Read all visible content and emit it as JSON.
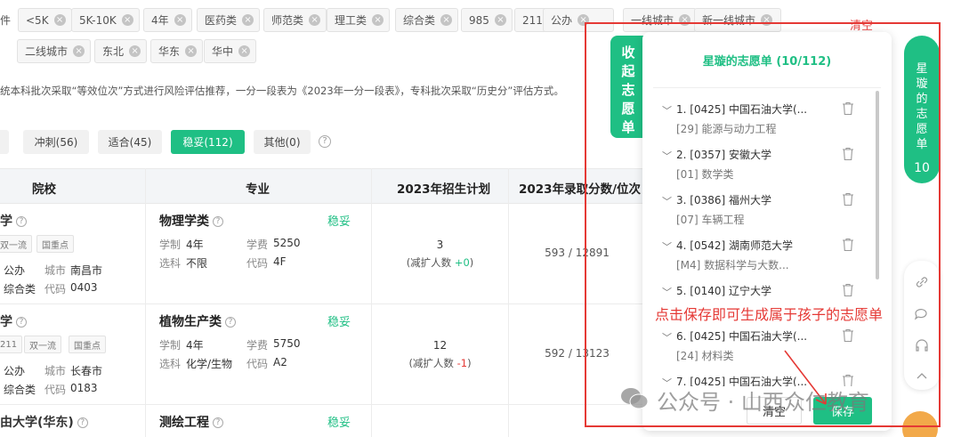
{
  "filters": {
    "row1_prefix": "件",
    "row1": [
      "<5K",
      "5K-10K",
      "4年",
      "医药类",
      "师范类",
      "理工类",
      "综合类",
      "985",
      "211",
      "公办",
      "一线城市",
      "新一线城市"
    ],
    "row2": [
      "二线城市",
      "东北",
      "华东",
      "华中"
    ],
    "clear_label": "清空"
  },
  "note": "统本科批次采取“等效位次”方式进行风险评估推荐，一分一段表为《2023年一分一段表》，专科批次采取“历史分”评估方式。",
  "category_tabs": {
    "partial_left": ")",
    "items": [
      "冲刺(56)",
      "适合(45)",
      "稳妥(112)",
      "其他(0)"
    ],
    "active": "稳妥(112)",
    "help": "?"
  },
  "table": {
    "headers": [
      "院校",
      "专业",
      "2023年招生计划",
      "2023年录取分数/位次"
    ],
    "rows": [
      {
        "school_partial": "学",
        "badges": [
          "双一流",
          "国重点"
        ],
        "nature_label": "公办",
        "city_label": "城市",
        "city": "南昌市",
        "type": "综合类",
        "code_label": "代码",
        "code": "0403",
        "major": "物理学类",
        "risk": "稳妥",
        "duration_label": "学制",
        "duration": "4年",
        "fee_label": "学费",
        "fee": "5250",
        "subject_label": "选科",
        "subject": "不限",
        "major_code_label": "代码",
        "major_code": "4F",
        "plan": "3",
        "plan_note_prefix": "(减扩人数 ",
        "plan_delta": "+0",
        "plan_note_suffix": ")",
        "score": "593 / 12891"
      },
      {
        "school_partial": "学",
        "badges": [
          "211",
          "双一流",
          "国重点"
        ],
        "nature_label": "公办",
        "city_label": "城市",
        "city": "长春市",
        "type": "综合类",
        "code_label": "代码",
        "code": "0183",
        "major": "植物生产类",
        "risk": "稳妥",
        "duration_label": "学制",
        "duration": "4年",
        "fee_label": "学费",
        "fee": "5750",
        "subject_label": "选科",
        "subject": "化学/生物",
        "major_code_label": "代码",
        "major_code": "A2",
        "plan": "12",
        "plan_note_prefix": "(减扩人数 ",
        "plan_delta": "-1",
        "plan_note_suffix": ")",
        "score": "592 / 13123"
      },
      {
        "school_partial": "由大学(华东)",
        "major": "测绘工程",
        "risk": "稳妥"
      }
    ]
  },
  "panel": {
    "collapse_tab": [
      "收",
      "起",
      "志",
      "愿",
      "单"
    ],
    "title": "星璇的志愿单 (10/112)",
    "items": [
      {
        "title": "1. [0425] 中国石油大学(...",
        "major": "[29] 能源与动力工程"
      },
      {
        "title": "2. [0357] 安徽大学",
        "major": "[01] 数学类"
      },
      {
        "title": "3. [0386] 福州大学",
        "major": "[07] 车辆工程"
      },
      {
        "title": "4. [0542] 湖南师范大学",
        "major": "[M4] 数据科学与大数..."
      },
      {
        "title": "5. [0140] 辽宁大学",
        "major": ""
      },
      {
        "title": "6. [0425] 中国石油大学(...",
        "major": "[24] 材料类"
      },
      {
        "title": "7. [0425] 中国石油大学(...",
        "major": ""
      }
    ],
    "clear_label": "清空",
    "save_label": "保存"
  },
  "right_tab": {
    "chars": [
      "星",
      "璇",
      "的",
      "志",
      "愿",
      "单"
    ],
    "count": "10"
  },
  "annotation": "点击保存即可生成属于孩子的志愿单",
  "watermark": "公众号 · 山西众仁教育",
  "colors": {
    "accent": "#1fbf84",
    "annotation_red": "#e53935",
    "negative": "#e53935"
  }
}
